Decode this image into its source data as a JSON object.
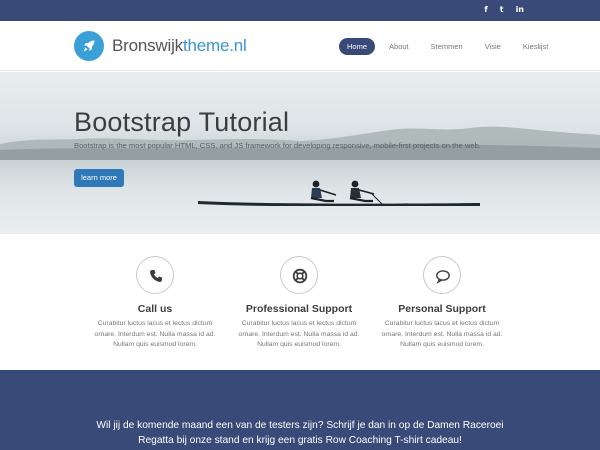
{
  "social": {
    "facebook": "f",
    "twitter": "t",
    "linkedin": "in",
    "icons": [
      "facebook-icon",
      "twitter-icon",
      "linkedin-icon"
    ]
  },
  "brand": {
    "name_plain": "Bronswijk",
    "name_accent": "theme.nl",
    "logo_icon": "rocket-icon"
  },
  "nav": {
    "items": [
      "Home",
      "About",
      "Stemmen",
      "Visie",
      "Kieslijst"
    ],
    "active": "Home"
  },
  "hero": {
    "title": "Bootstrap Tutorial",
    "subtitle": "Bootstrap is the most popular HTML, CSS, and JS framework for developing responsive, mobile-first projects on the web.",
    "button": "learn more"
  },
  "features": [
    {
      "icon": "phone-icon",
      "title": "Call us",
      "text": "Curabitur luctus lacus et lectus dictum ornare. Interdum est. Nulla massa id ad. Nullam quis euismod lorem."
    },
    {
      "icon": "lifebuoy-icon",
      "title": "Professional Support",
      "text": "Curabitur luctus lacus et lectus dictum ornare. Interdum est. Nulla massa id ad. Nullam quis euismod lorem."
    },
    {
      "icon": "chat-bubble-icon",
      "title": "Personal Support",
      "text": "Curabitur luctus lacus et lectus dictum ornare. Interdum est. Nulla massa id ad. Nullam quis euismod lorem."
    }
  ],
  "banner": {
    "text": "Wil jij de komende maand een van de testers zijn? Schrijf je dan in op de Damen Raceroei Regatta bij onze stand en krijg een gratis Row Coaching T-shirt cadeau!"
  },
  "colors": {
    "navy": "#3a4a78",
    "accent_blue": "#3a94d0",
    "button_blue": "#2f79b9"
  }
}
